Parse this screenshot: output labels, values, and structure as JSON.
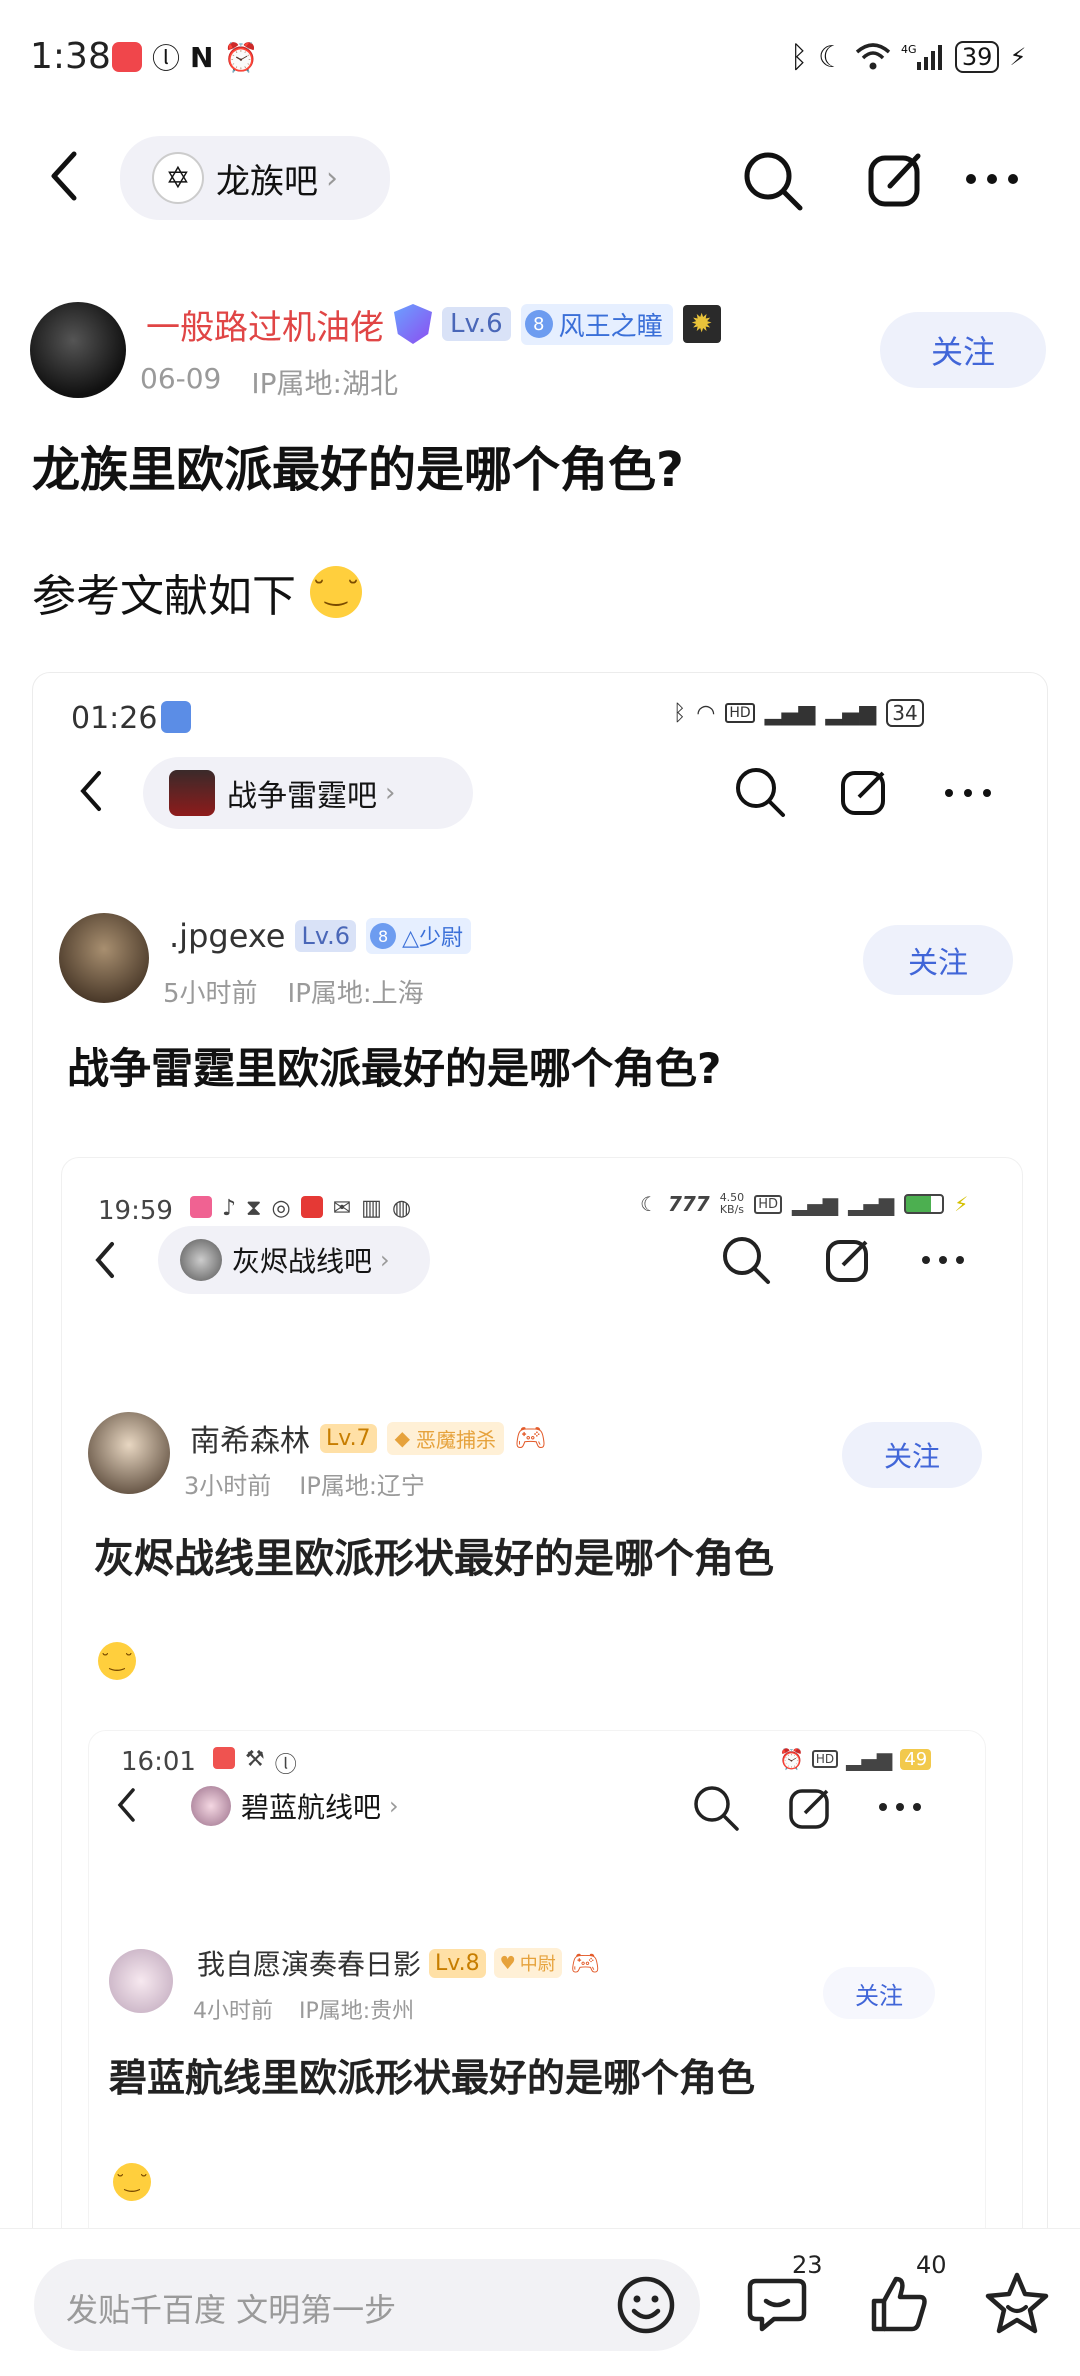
{
  "status_bar": {
    "time": "1:38",
    "battery": "39"
  },
  "nav": {
    "forum_name": "龙族吧"
  },
  "post": {
    "author": "一般路过机油佬",
    "level": "Lv.6",
    "member_level": "8",
    "title_badge": "风王之瞳",
    "date": "06-09",
    "ip": "IP属地:湖北",
    "follow": "关注",
    "title": "龙族里欧派最好的是哪个角色?",
    "body": "参考文献如下"
  },
  "screenshot1": {
    "time": "01:26",
    "battery": "34",
    "forum_name": "战争雷霆吧",
    "author": ".jpgexe",
    "level": "Lv.6",
    "member_level": "8",
    "title_badge": "△少尉",
    "time_ago": "5小时前",
    "ip": "IP属地:上海",
    "follow": "关注",
    "title": "战争雷霆里欧派最好的是哪个角色?"
  },
  "screenshot2": {
    "time": "19:59",
    "net_speed": "4.50",
    "net_unit": "KB/s",
    "forum_name": "灰烬战线吧",
    "author": "南希森林",
    "level": "Lv.7",
    "title_badge": "恶魔捕杀",
    "time_ago": "3小时前",
    "ip": "IP属地:辽宁",
    "follow": "关注",
    "title": "灰烬战线里欧派形状最好的是哪个角色"
  },
  "screenshot3": {
    "time": "16:01",
    "battery": "49",
    "forum_name": "碧蓝航线吧",
    "author": "我自愿演奏春日影",
    "level": "Lv.8",
    "title_badge": "中尉",
    "time_ago": "4小时前",
    "ip": "IP属地:贵州",
    "follow": "关注",
    "title": "碧蓝航线里欧派形状最好的是哪个角色"
  },
  "bottom_bar": {
    "input_placeholder": "发贴千百度 文明第一步",
    "comment_count": "23",
    "like_count": "40"
  },
  "colors": {
    "nickname": "#e04545",
    "follow_text": "#4166d8",
    "level_badge_bg": "#d9e2f7"
  }
}
